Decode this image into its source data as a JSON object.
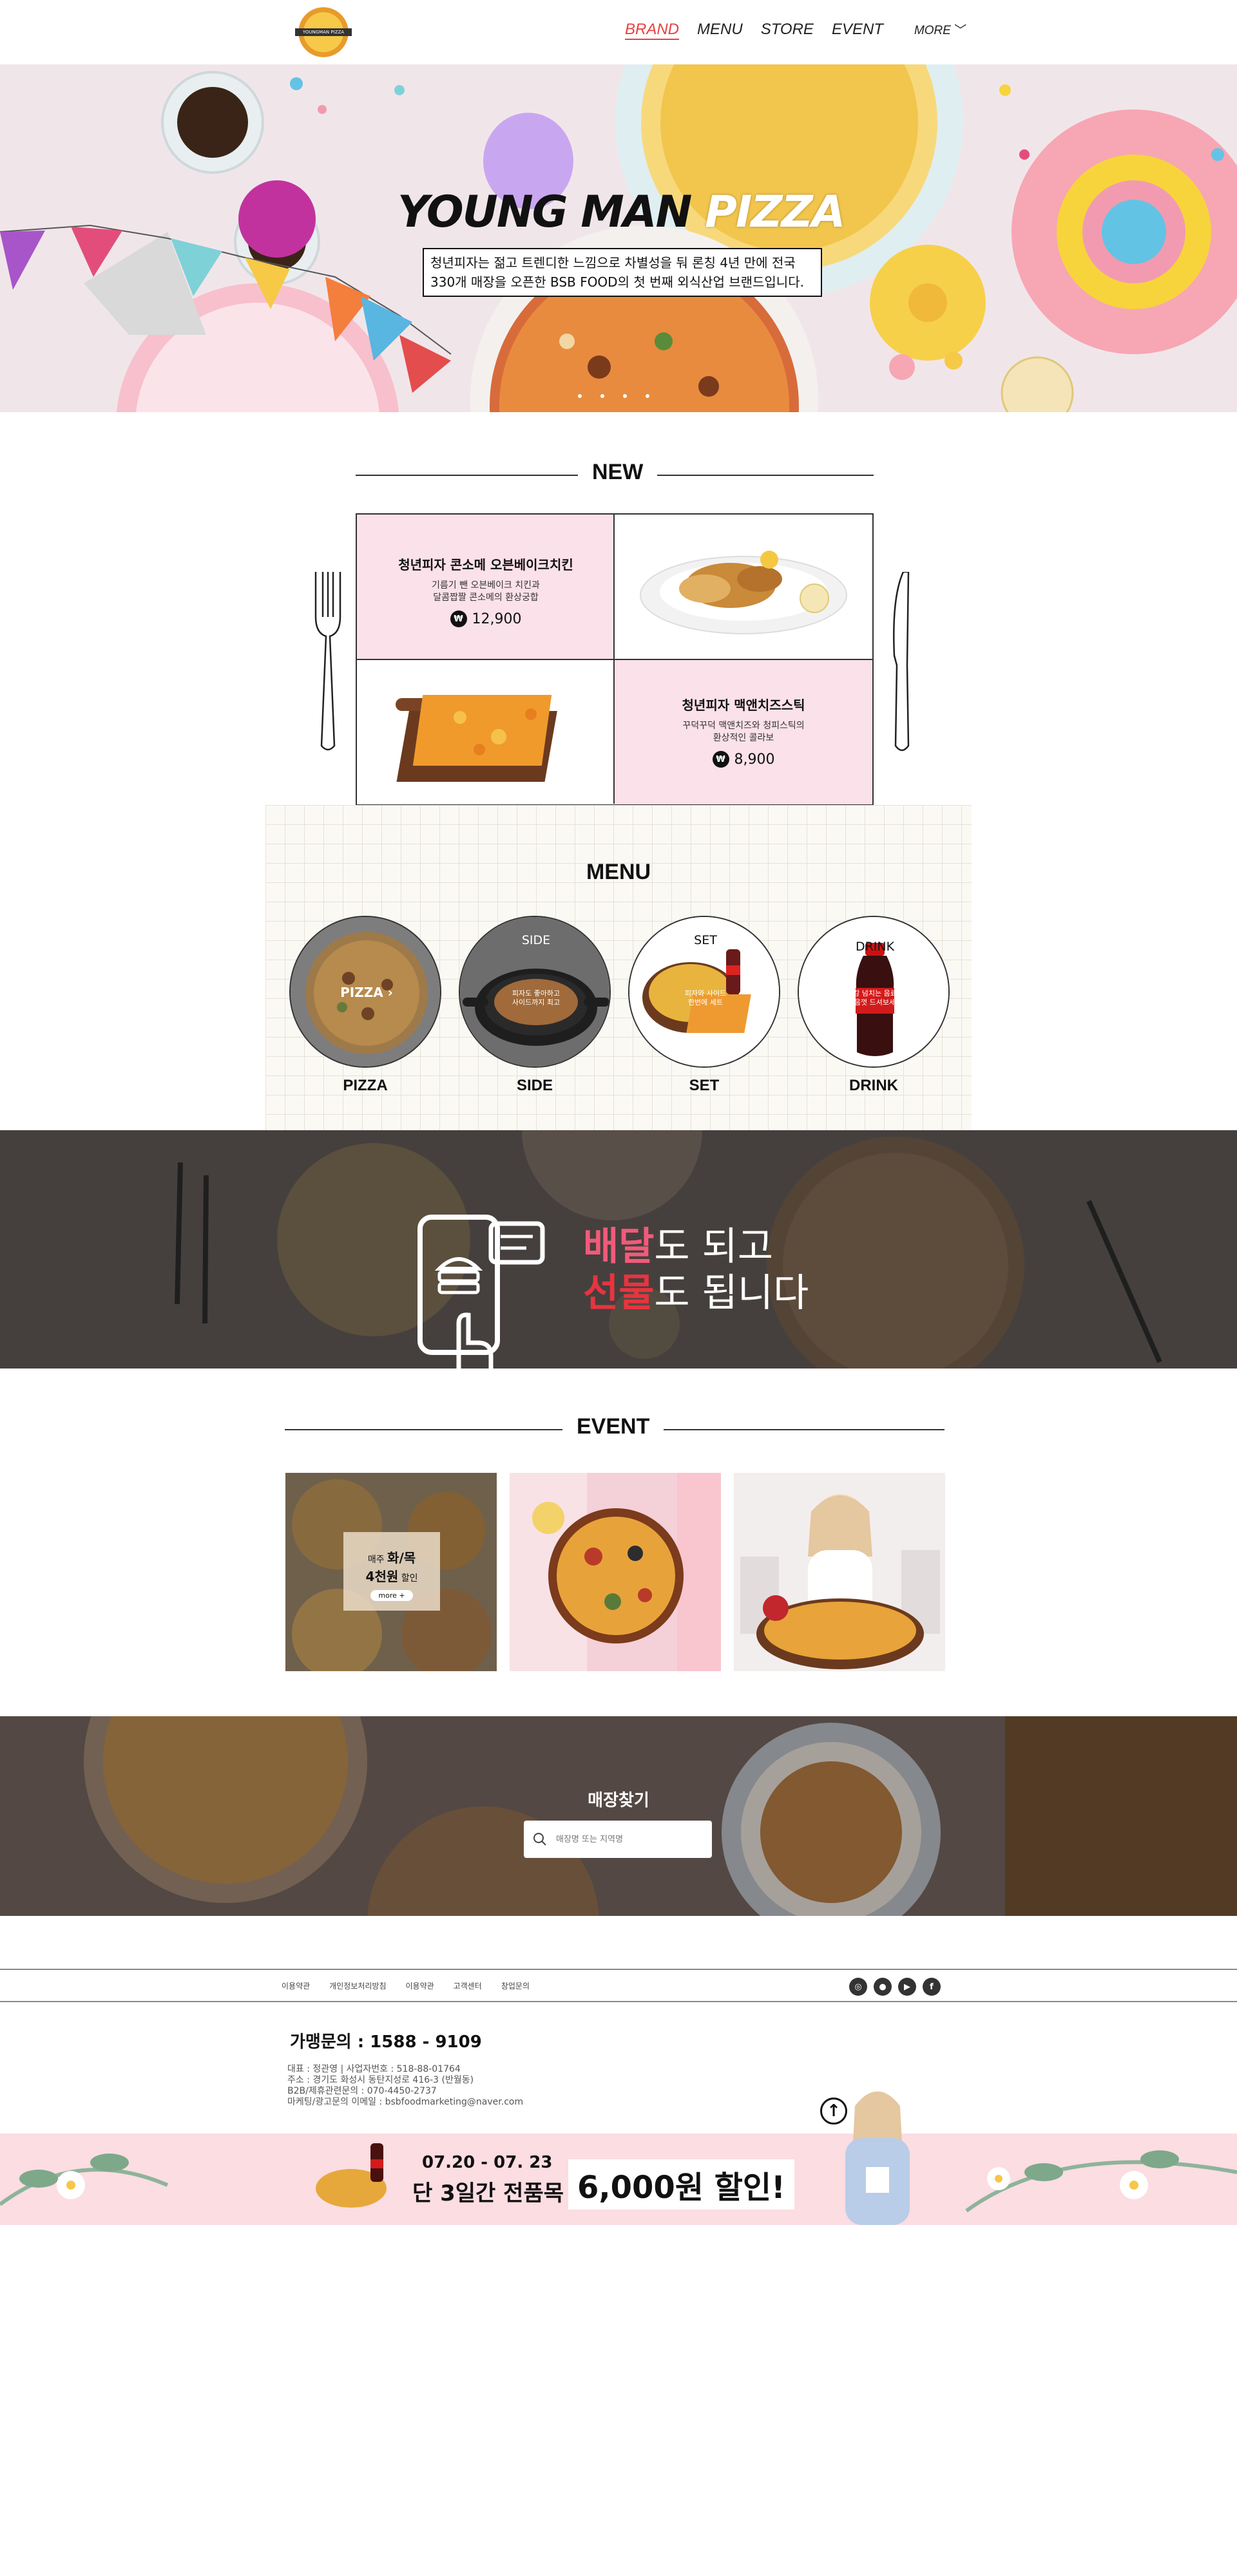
{
  "header": {
    "logo_text": "YOUNGMAN PIZZA",
    "nav": [
      "BRAND",
      "MENU",
      "STORE",
      "EVENT"
    ],
    "more": "MORE"
  },
  "hero": {
    "title_main": "YOUNG MAN",
    "title_accent": "PIZZA",
    "desc_line1": "청년피자는 젊고 트렌디한 느낌으로 차별성을 둬 론칭 4년 만에 전국",
    "desc_line2": "330개 매장을 오픈한 BSB FOOD의 첫 번째 외식산업 브랜드입니다."
  },
  "new_section": {
    "title": "NEW",
    "products": [
      {
        "name": "청년피자 콘소메 오븐베이크치킨",
        "desc1": "기름기 뺀 오븐베이크 치킨과",
        "desc2": "달콤짭짤 콘소메의 환상궁합",
        "price": "12,900"
      },
      {
        "name": "청년피자 맥앤치즈스틱",
        "desc1": "꾸덕꾸덕 맥앤치즈와 청피스틱의",
        "desc2": "환상적인 콜라보",
        "price": "8,900"
      }
    ],
    "won_symbol": "₩"
  },
  "menu_section": {
    "title": "MENU",
    "items": [
      {
        "label": "PIZZA",
        "overlay": "PIZZA"
      },
      {
        "label": "SIDE",
        "overlay": "SIDE",
        "note1": "피자도 좋아하고",
        "note2": "사이드까지 최고"
      },
      {
        "label": "SET",
        "overlay": "SET",
        "note1": "피자와 사이드",
        "note2": "한번에 세트"
      },
      {
        "label": "DRINK",
        "overlay": "DRINK",
        "note1": "청량감 넘치는 음료까지",
        "note2": "마음껏 드셔보세요"
      }
    ]
  },
  "delivery": {
    "line1_hl": "배달",
    "line1_rest": "도 되고",
    "line2_hl": "선물",
    "line2_rest": "도 됩니다"
  },
  "event_section": {
    "title": "EVENT",
    "card1_pre": "매주",
    "card1_days": "화/목",
    "card1_amount": "4천원",
    "card1_post": "할인",
    "card1_btn": "more +"
  },
  "store_finder": {
    "title": "매장찾기",
    "placeholder": "매장명 또는 지역명"
  },
  "footer": {
    "links": [
      "이용약관",
      "개인정보처리방침",
      "이용약관",
      "고객센터",
      "창업문의"
    ],
    "social": [
      "◎",
      "●",
      "▶",
      "f"
    ],
    "franchise": "가맹문의 : 1588 - 9109",
    "company_lines": [
      "대표 : 정관영  |  사업자번호 : 518-88-01764",
      "주소 : 경기도 화성시 동탄지성로 416-3 (반월동)",
      "B2B/제휴관련문의 : 070-4450-2737",
      "마케팅/광고문의 이메일 : bsbfoodmarketing@naver.com"
    ]
  },
  "promo": {
    "date": "07.20 - 07. 23",
    "sub": "단 3일간 전품목",
    "big": "6,000원 할인!"
  },
  "colors": {
    "accent_red": "#e84040",
    "pink_cell": "#fbe1e9",
    "promo_pink": "#fbdde2"
  }
}
